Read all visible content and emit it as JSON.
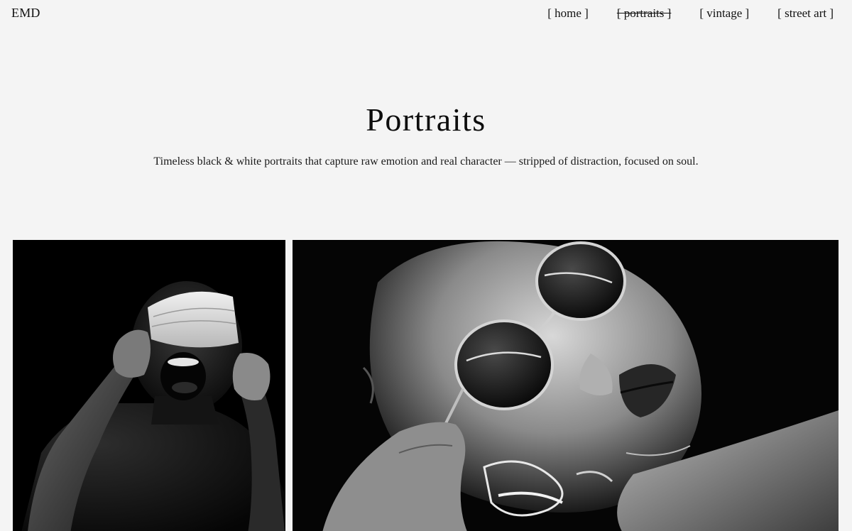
{
  "brand": {
    "logo_text": "EMD"
  },
  "nav": {
    "items": [
      {
        "label": "[ home ]",
        "active": false
      },
      {
        "label": "[ portraits ]",
        "active": true
      },
      {
        "label": "[ vintage ]",
        "active": false
      },
      {
        "label": "[ street art ]",
        "active": false
      }
    ]
  },
  "hero": {
    "title": "Portraits",
    "subtitle": "Timeless black & white portraits that capture raw emotion and real character — stripped of distraction, focused on soul."
  },
  "gallery": {
    "photos": [
      {
        "subject": "man screaming with face mask pulled over eyes"
      },
      {
        "subject": "woman with round sunglasses lying in dark water"
      }
    ]
  },
  "colors": {
    "background": "#f4f4f4",
    "text": "#111111",
    "photo_bg": "#000000"
  }
}
